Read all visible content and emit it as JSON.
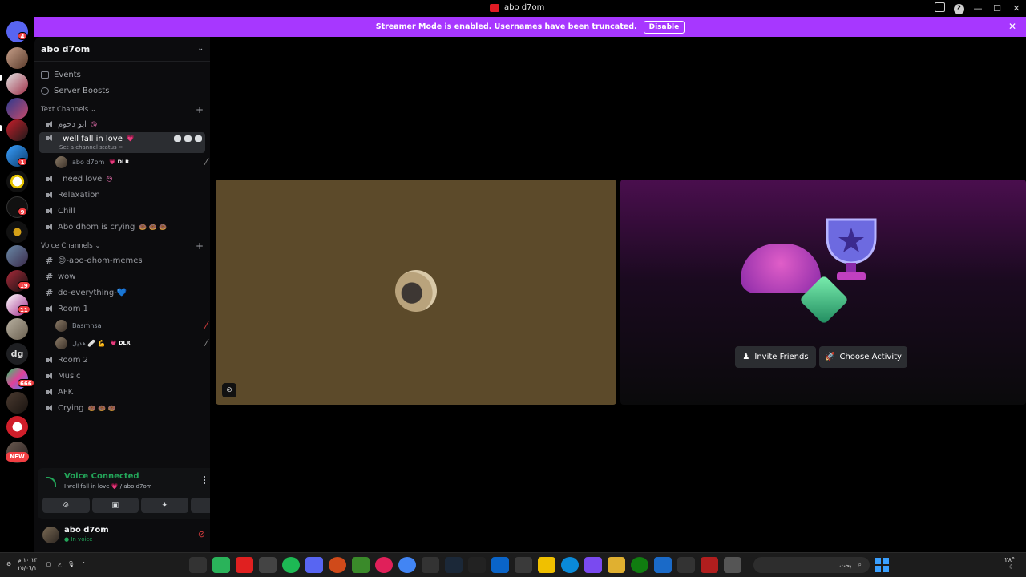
{
  "window": {
    "title": "abo d7om"
  },
  "banner": {
    "text": "Streamer Mode is enabled. Usernames have been truncated.",
    "disable": "Disable"
  },
  "guilds": {
    "badges": [
      {
        "label": "4"
      },
      {
        "label": "1"
      },
      {
        "label": "9"
      },
      {
        "label": "19"
      },
      {
        "label": "11"
      },
      {
        "label": "666"
      }
    ],
    "text_icon": "dg",
    "new_label": "NEW"
  },
  "server": {
    "name": "abo d7om",
    "events": "Events",
    "boosts": "Server Boosts",
    "text_category": "Text Channels",
    "voice_category": "Voice Channels",
    "channels_top": [
      {
        "name": "ابو دحوم",
        "emoji": "😘"
      }
    ],
    "active_channel": {
      "name": "I well fall in love",
      "emoji": "💗",
      "status_hint": "Set a channel status ✏"
    },
    "active_users": [
      {
        "name": "abo d7om",
        "badge": "💗 DLR"
      }
    ],
    "channels_mid": [
      {
        "name": "I need love",
        "emoji": "😔"
      },
      {
        "name": "Relaxation",
        "emoji": ""
      },
      {
        "name": "Chill",
        "emoji": ""
      },
      {
        "name": "Abo dhom is crying",
        "emoji": "🍩 🍩 🍩"
      }
    ],
    "text_channels": [
      {
        "name": "😊-abo-dhom-memes"
      },
      {
        "name": "wow"
      },
      {
        "name": "do-everything-💙"
      }
    ],
    "room1": {
      "name": "Room 1"
    },
    "room1_users": [
      {
        "name": "Basmhsa",
        "badge": ""
      },
      {
        "name": "هديل 🩹 💪",
        "badge": "💗 DLR"
      }
    ],
    "voice_rest": [
      {
        "name": "Room 2",
        "emoji": ""
      },
      {
        "name": "Music",
        "emoji": ""
      },
      {
        "name": "AFK",
        "emoji": ""
      },
      {
        "name": "Crying",
        "emoji": "🍩 🍩 🍩"
      }
    ]
  },
  "voice_panel": {
    "status": "Voice Connected",
    "where": "I well fall in love 💗 / abo d7om"
  },
  "user_panel": {
    "name": "abo d7om",
    "sub": "● In voice"
  },
  "activity": {
    "invite": "Invite Friends",
    "choose": "Choose Activity"
  },
  "taskbar": {
    "time": "١٠:١٣ م",
    "date": "٢٥/٠٦/١٠",
    "lang": "ع",
    "search_placeholder": "بحث",
    "temp": "٢٨°"
  },
  "colors": {
    "accent": "#a737ff",
    "green": "#23a559",
    "red": "#d83c3e",
    "tile": "#5c4a2a"
  }
}
